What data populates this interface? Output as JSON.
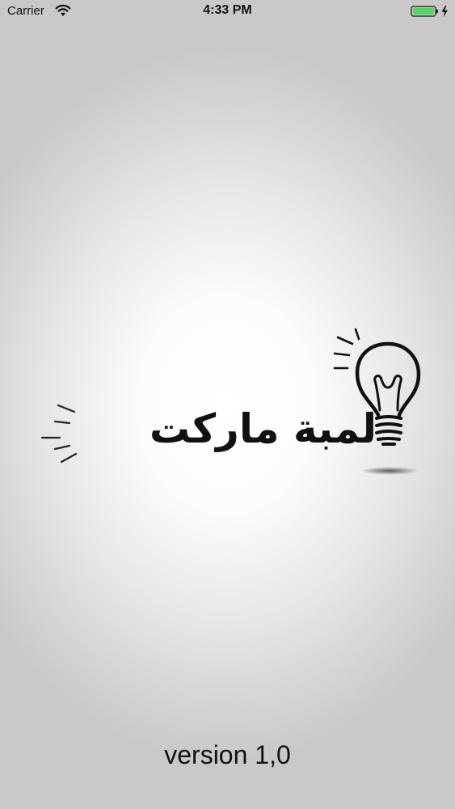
{
  "status_bar": {
    "carrier": "Carrier",
    "time": "4:33 PM",
    "wifi_icon": "wifi-icon",
    "battery_icon": "battery-charging-icon",
    "battery_color": "#4cd964"
  },
  "splash": {
    "logo_text": "لمبة ماركت",
    "logo_icon": "lightbulb-icon",
    "version_text": "version 1,0"
  }
}
